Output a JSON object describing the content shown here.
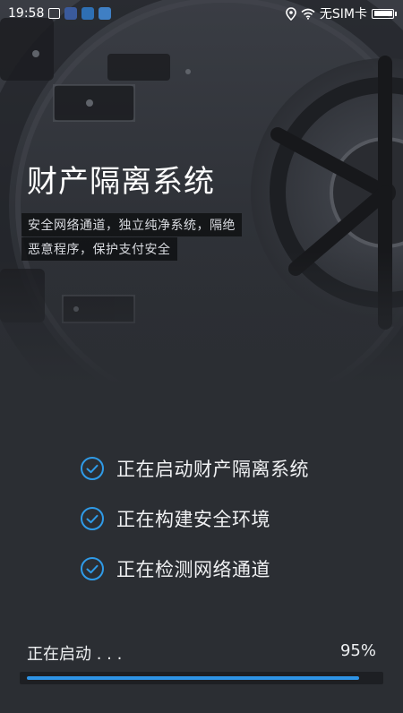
{
  "status_bar": {
    "time": "19:58",
    "carrier": "无SIM卡",
    "icons": [
      "screenshot-icon",
      "notification-icon",
      "notification-icon",
      "notification-icon",
      "location-icon",
      "wifi-icon",
      "battery-icon"
    ]
  },
  "hero": {
    "title": "财产隔离系统",
    "desc_line1": "安全网络通道，独立纯净系统，隔绝",
    "desc_line2": "恶意程序，保护支付安全"
  },
  "steps": [
    {
      "label": "正在启动财产隔离系统",
      "icon": "check-circle-icon"
    },
    {
      "label": "正在构建安全环境",
      "icon": "check-circle-icon"
    },
    {
      "label": "正在检测网络通道",
      "icon": "check-circle-icon"
    }
  ],
  "progress": {
    "label": "正在启动 . . .",
    "percent_text": "95%",
    "value": 0.95
  },
  "colors": {
    "accent": "#2e94e6",
    "background": "#2b2e33"
  }
}
